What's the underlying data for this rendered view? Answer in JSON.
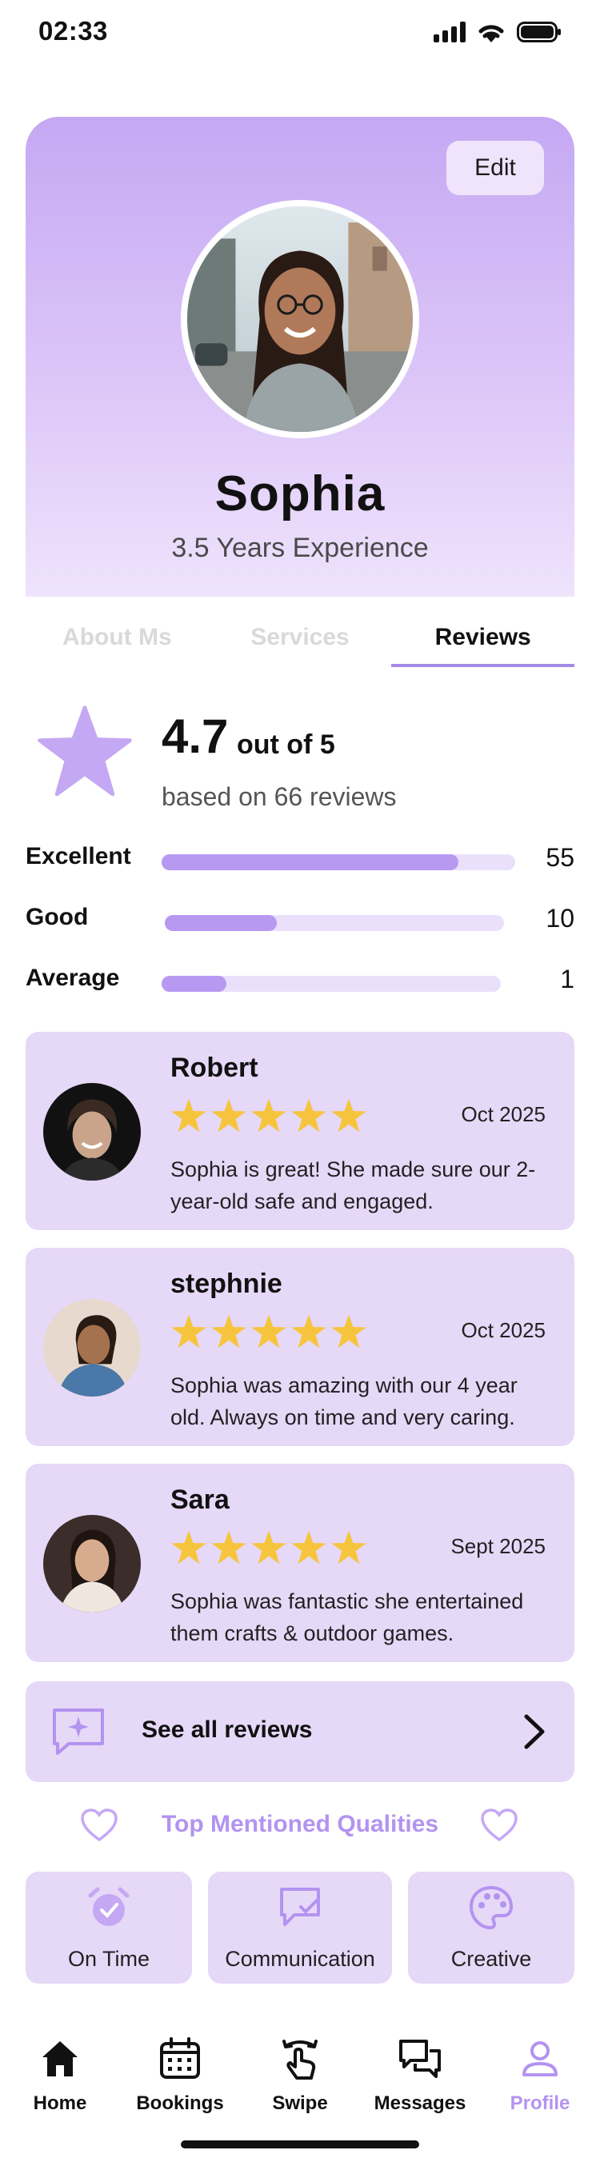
{
  "status": {
    "time": "02:33"
  },
  "profile": {
    "edit_label": "Edit",
    "name": "Sophia",
    "experience": "3.5 Years Experience"
  },
  "tabs": [
    {
      "label": "About Ms"
    },
    {
      "label": "Services"
    },
    {
      "label": "Reviews",
      "active": true
    }
  ],
  "rating": {
    "score": "4.7",
    "out_of": "out of 5",
    "based_on": "based on 66 reviews",
    "breakdown": [
      {
        "label": "Excellent",
        "count": "55",
        "fill": 0.84
      },
      {
        "label": "Good",
        "count": "10",
        "fill": 0.33
      },
      {
        "label": "Average",
        "count": "1",
        "fill": 0.19
      }
    ]
  },
  "reviews": [
    {
      "name": "Robert",
      "date": "Oct 2025",
      "stars": 5,
      "text": "Sophia is great! She made sure our 2-year-old safe and engaged."
    },
    {
      "name": "stephnie",
      "date": "Oct 2025",
      "stars": 5,
      "text": "Sophia was amazing with our 4 year old. Always on time and very caring."
    },
    {
      "name": "Sara",
      "date": "Sept 2025",
      "stars": 5,
      "text": "Sophia was fantastic she entertained them crafts & outdoor games."
    }
  ],
  "see_all_label": "See all reviews",
  "qualities": {
    "title": "Top Mentioned Qualities",
    "items": [
      {
        "label": "On Time",
        "icon": "alarm-clock-icon"
      },
      {
        "label": "Communication",
        "icon": "chat-check-icon"
      },
      {
        "label": "Creative",
        "icon": "palette-icon"
      }
    ]
  },
  "nav": [
    {
      "label": "Home",
      "icon": "home-icon"
    },
    {
      "label": "Bookings",
      "icon": "calendar-icon"
    },
    {
      "label": "Swipe",
      "icon": "swipe-hand-icon"
    },
    {
      "label": "Messages",
      "icon": "messages-icon"
    },
    {
      "label": "Profile",
      "icon": "profile-icon",
      "active": true
    }
  ],
  "colors": {
    "accent": "#b393f0",
    "card_bg": "#e6d8f7",
    "star": "#f7c53d"
  }
}
